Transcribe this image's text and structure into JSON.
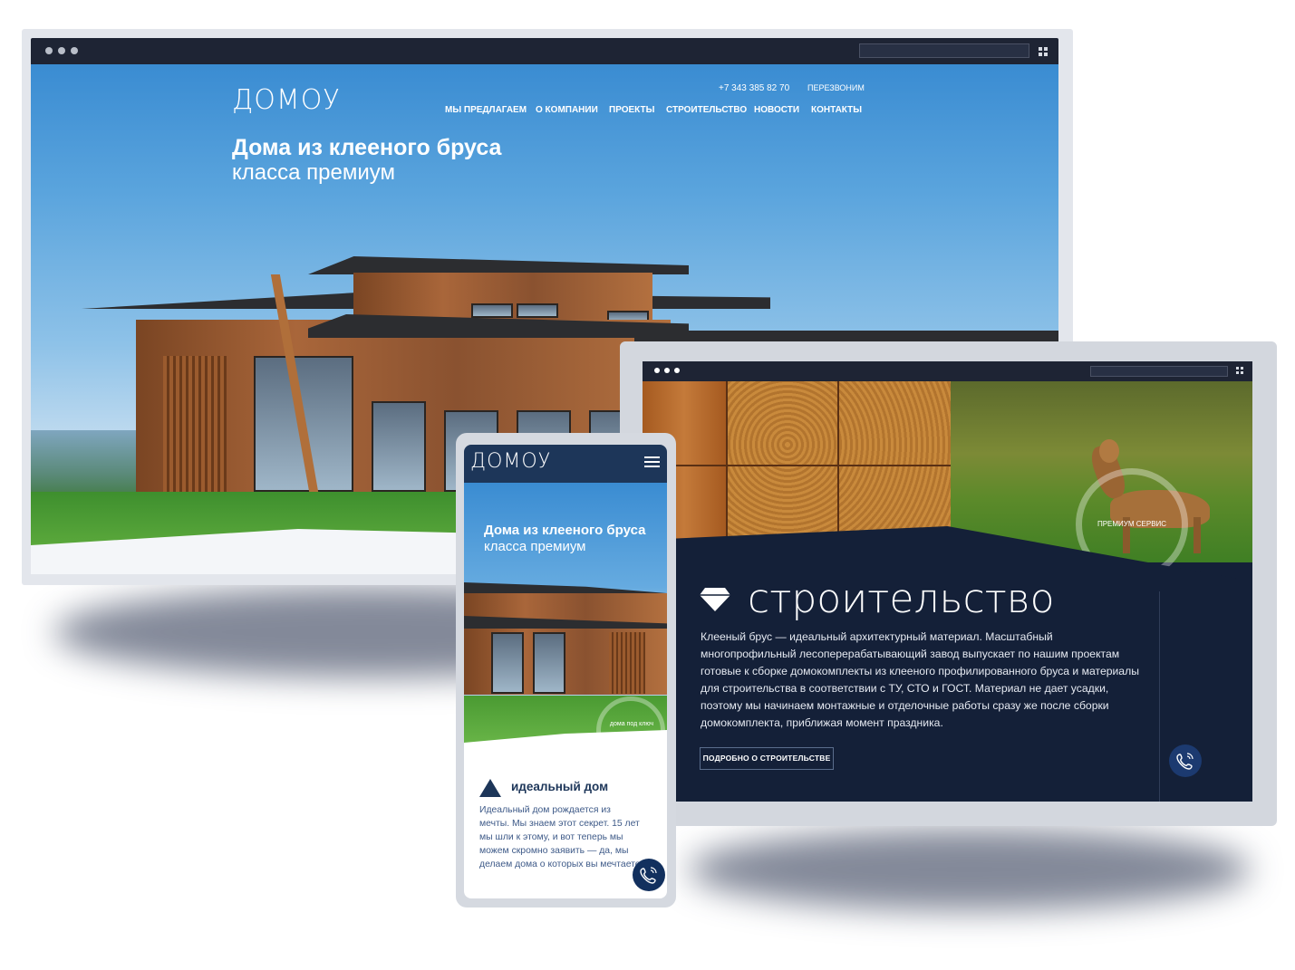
{
  "brand": {
    "logo": "ДОМОУ"
  },
  "desktop": {
    "header": {
      "phone": "+7 343 385 82 70",
      "callback": "ПЕРЕЗВОНИМ",
      "nav": [
        "МЫ ПРЕДЛАГАЕМ",
        "О КОМПАНИИ",
        "ПРОЕКТЫ",
        "СТРОИТЕЛЬСТВО",
        "НОВОСТИ",
        "КОНТАКТЫ"
      ]
    },
    "hero": {
      "title": "Дома из клееного бруса",
      "subtitle": "класса премиум"
    }
  },
  "tablet": {
    "badge": "ПРЕМИУМ СЕРВИС",
    "section_title": "строительство",
    "paragraph": "Клееный брус — идеальный архитектурный материал. Масштабный многопрофильный лесоперерабатывающий завод выпускает по нашим проектам готовые к сборке домокомплекты из клееного профилированного бруса и материалы для строительства в соответствии с ТУ, СТО и ГОСТ. Материал не дает усадки, поэтому мы начинаем монтажные и отделочные работы сразу же после сборки домокомплекта, приближая момент праздника.",
    "button": "ПОДРОБНО О СТРОИТЕЛЬСТВЕ"
  },
  "mobile": {
    "hero_title": "Дома из клееного бруса",
    "hero_subtitle": "класса премиум",
    "badge": "дома под ключ",
    "section_title": "идеальный дом",
    "paragraph": "Идеальный дом рождается из мечты. Мы знаем этот секрет. 15 лет мы шли к этому, и вот теперь мы можем скромно заявить — да, мы делаем дома о которых вы мечтаете"
  },
  "colors": {
    "navy": "#142038",
    "header_bar": "#1e2434",
    "accent_blue": "#1c3a70",
    "sky": "#3a8cd2"
  },
  "icons": [
    "browser-dots-icon",
    "grid-icon",
    "diamond-icon",
    "triangle-icon",
    "phone-icon",
    "burger-menu-icon"
  ]
}
